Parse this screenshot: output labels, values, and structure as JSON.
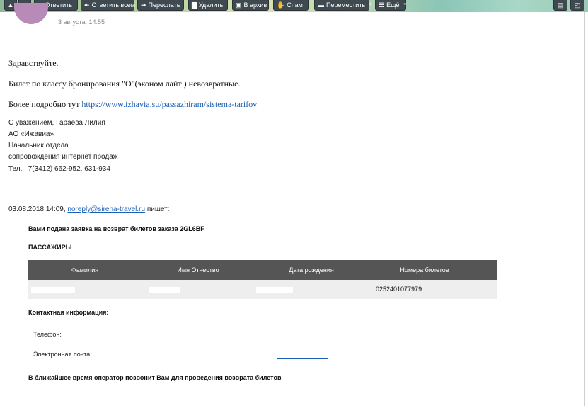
{
  "toolbar": {
    "up_icon": "arrow-up-icon",
    "down_icon": "chevron-down-icon",
    "reply": "Ответить",
    "reply_all": "Ответить всем",
    "forward": "Переслать",
    "delete": "Удалить",
    "archive": "В архив",
    "spam": "Спам",
    "move": "Переместить",
    "more": "Ещё"
  },
  "header": {
    "date": "3 августа, 14:55"
  },
  "body": {
    "greeting": "Здравствуйте.",
    "line1": "Билет по классу бронирования \"О\"(эконом лайт ) невозвратные.",
    "more_prefix": "Более подробно тут ",
    "more_link": "https://www.izhavia.su/passazhiram/sistema-tarifov",
    "signature": [
      "С уважением, Гараева Лилия",
      "АО «Ижавиа»",
      "Начальник отдела",
      "сопровождения интернет продаж",
      "Тел.   7(3412) 662-952, 631-934"
    ]
  },
  "quote": {
    "prefix": "03.08.2018 14:09, ",
    "email": "noreply@sirena-travel.ru",
    "suffix": " пишет:",
    "title": "Вами подана заявка на возврат билетов заказа 2GL6BF",
    "passengers_heading": "ПАССАЖИРЫ",
    "columns": [
      "Фамилия",
      "Имя Отчество",
      "Дата рождения",
      "Номера билетов"
    ],
    "row": {
      "ticket": "0252401077979"
    },
    "contact_heading": "Контактная информация:",
    "phone_label": "Телефон:",
    "email_label": "Электронная почта:",
    "footer": "В ближайшее время оператор позвонит Вам для проведения возврата билетов"
  },
  "colors": {
    "toolbar_button": "#3f4a50",
    "table_header": "#555555",
    "table_row": "#eeeeee",
    "link": "#1a5fb4"
  }
}
